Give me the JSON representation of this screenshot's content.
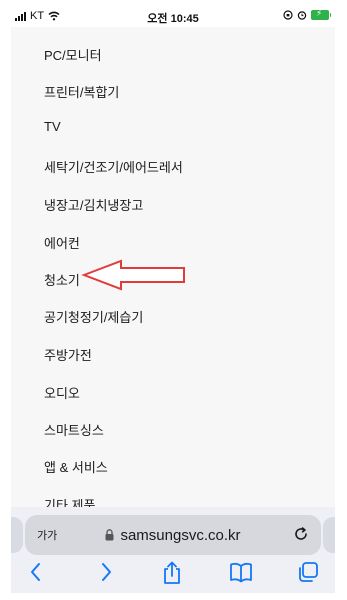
{
  "status_bar": {
    "carrier": "KT",
    "time": "오전 10:45"
  },
  "menu": {
    "items": [
      {
        "label": "PC/모니터"
      },
      {
        "label": "프린터/복합기"
      },
      {
        "label": "TV"
      },
      {
        "label": "세탁기/건조기/에어드레서"
      },
      {
        "label": "냉장고/김치냉장고"
      },
      {
        "label": "에어컨"
      },
      {
        "label": "청소기"
      },
      {
        "label": "공기청정기/제습기"
      },
      {
        "label": "주방가전"
      },
      {
        "label": "오디오"
      },
      {
        "label": "스마트싱스"
      },
      {
        "label": "앱 & 서비스"
      },
      {
        "label": "기타 제품"
      }
    ]
  },
  "annotation": {
    "color": "#e23b3b",
    "points_to": "청소기"
  },
  "browser": {
    "text_size_button": "가가",
    "url": "samsungsvc.co.kr"
  },
  "colors": {
    "accent": "#1677f5",
    "battery": "#2fb24a"
  }
}
